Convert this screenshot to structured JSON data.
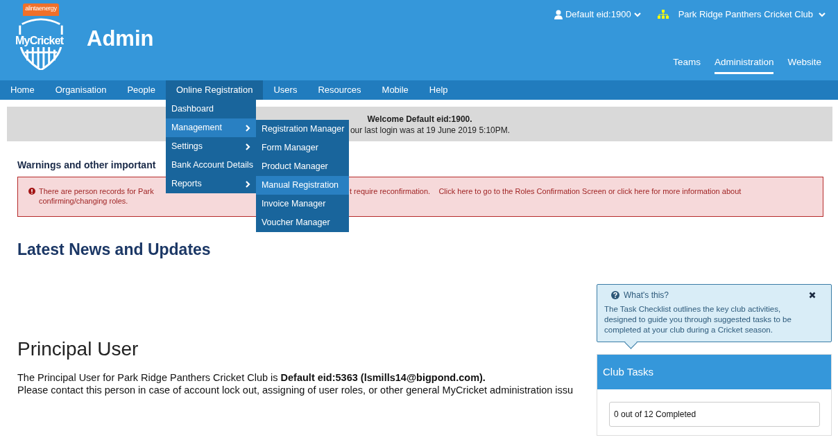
{
  "header": {
    "logo": {
      "sponsor": "alintaenergy",
      "name": "MyCricket"
    },
    "title": "Admin",
    "user_menu": "Default eid:1900",
    "club_menu": "Park Ridge Panthers Cricket Club",
    "tabs": [
      {
        "label": "Teams",
        "selected": false
      },
      {
        "label": "Administration",
        "selected": true
      },
      {
        "label": "Website",
        "selected": false
      }
    ]
  },
  "nav": {
    "items": [
      {
        "label": "Home",
        "selected": false
      },
      {
        "label": "Organisation",
        "selected": false
      },
      {
        "label": "People",
        "selected": false
      },
      {
        "label": "Online Registration",
        "selected": true
      },
      {
        "label": "Users",
        "selected": false
      },
      {
        "label": "Resources",
        "selected": false
      },
      {
        "label": "Mobile",
        "selected": false
      },
      {
        "label": "Help",
        "selected": false
      }
    ],
    "dropdown": [
      {
        "label": "Dashboard",
        "has_submenu": false,
        "selected": false
      },
      {
        "label": "Management",
        "has_submenu": true,
        "selected": true
      },
      {
        "label": "Settings",
        "has_submenu": true,
        "selected": false
      },
      {
        "label": "Bank Account Details",
        "has_submenu": false,
        "selected": false
      },
      {
        "label": "Reports",
        "has_submenu": true,
        "selected": false
      }
    ],
    "submenu": [
      {
        "label": "Registration Manager",
        "selected": false
      },
      {
        "label": "Form Manager",
        "selected": false
      },
      {
        "label": "Product Manager",
        "selected": false
      },
      {
        "label": "Manual Registration",
        "selected": true
      },
      {
        "label": "Invoice Manager",
        "selected": false
      },
      {
        "label": "Voucher Manager",
        "selected": false
      }
    ]
  },
  "welcome": {
    "title": "Welcome Default eid:1900.",
    "last_login": "our last login was at 19 June 2019 5:10PM."
  },
  "warnings": {
    "heading": "Warnings and other important",
    "alert": {
      "text_start": "There are person records for Park",
      "text_end": "t require reconfirmation.    Click here to go to the Roles Confirmation Screen or click here for more information about",
      "text_line2": "confirming/changing roles."
    }
  },
  "news": {
    "heading": "Latest News and Updates"
  },
  "principal": {
    "heading": "Principal User",
    "line1": "The Principal User for Park Ridge Panthers Cricket Club is **Default eid:5363 (lsmills14@bigpond.com).**",
    "line2": "Please contact this person in case of account lock out, assigning of user roles, or other general MyCricket administration issu"
  },
  "help_tip": {
    "title": "What's this?",
    "text": "The Task Checklist outlines the key club activities, designed to guide you through suggested tasks to be completed at your club during a Cricket season."
  },
  "club_tasks": {
    "title": "Club Tasks",
    "progress": "0 out of 12 Completed"
  }
}
